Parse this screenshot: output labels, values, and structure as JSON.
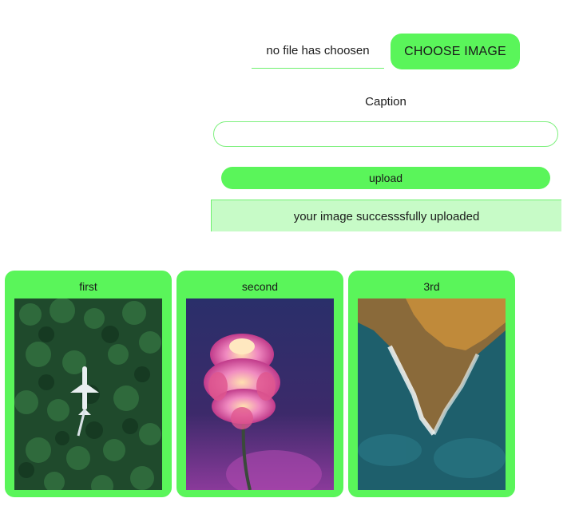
{
  "upload_form": {
    "file_status": "no file has choosen",
    "choose_button": "CHOOSE IMAGE",
    "caption_label": "Caption",
    "caption_value": "",
    "upload_button": "upload",
    "success_message": "your image successsfully uploaded"
  },
  "gallery": {
    "cards": [
      {
        "title": "first",
        "image": "aerial forest with airplane"
      },
      {
        "title": "second",
        "image": "pink dahlia flower"
      },
      {
        "title": "3rd",
        "image": "aerial coastline with waves"
      }
    ]
  },
  "colors": {
    "accent": "#5af55a",
    "success_bg": "#c7fbc7",
    "border": "#6ef06e"
  }
}
